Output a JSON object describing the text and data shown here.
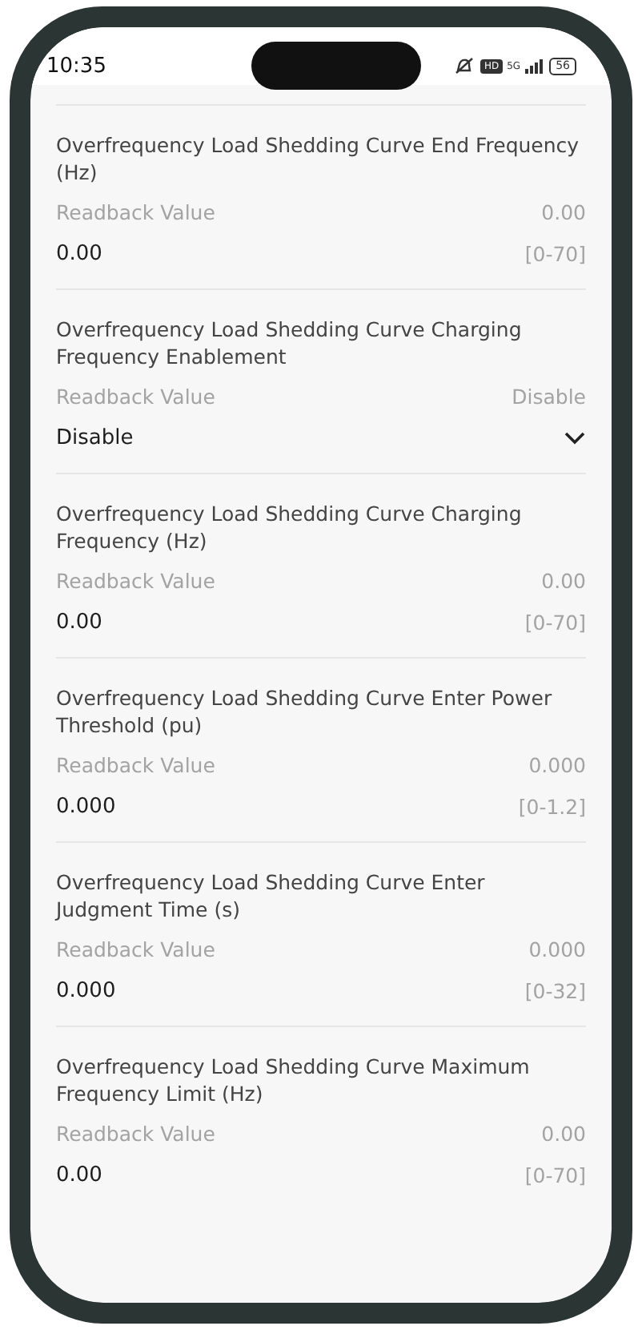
{
  "status_bar": {
    "time": "10:35",
    "hd": "HD",
    "network": "5G",
    "battery": "56"
  },
  "settings": [
    {
      "kind": "number",
      "title": "Overfrequency Load Shedding Curve End Frequency (Hz)",
      "readback_label": "Readback Value",
      "readback_value": "0.00",
      "value": "0.00",
      "range": "[0-70]"
    },
    {
      "kind": "select",
      "title": "Overfrequency Load Shedding Curve Charging Frequency Enablement",
      "readback_label": "Readback Value",
      "readback_value": "Disable",
      "value": "Disable"
    },
    {
      "kind": "number",
      "title": "Overfrequency Load Shedding Curve Charging Frequency (Hz)",
      "readback_label": "Readback Value",
      "readback_value": "0.00",
      "value": "0.00",
      "range": "[0-70]"
    },
    {
      "kind": "number",
      "title": "Overfrequency Load Shedding Curve Enter Power Threshold (pu)",
      "readback_label": "Readback Value",
      "readback_value": "0.000",
      "value": "0.000",
      "range": "[0-1.2]"
    },
    {
      "kind": "number",
      "title": "Overfrequency Load Shedding Curve Enter Judgment Time (s)",
      "readback_label": "Readback Value",
      "readback_value": "0.000",
      "value": "0.000",
      "range": "[0-32]"
    },
    {
      "kind": "number",
      "title": "Overfrequency Load Shedding Curve Maximum Frequency Limit (Hz)",
      "readback_label": "Readback Value",
      "readback_value": "0.00",
      "value": "0.00",
      "range": "[0-70]"
    }
  ]
}
